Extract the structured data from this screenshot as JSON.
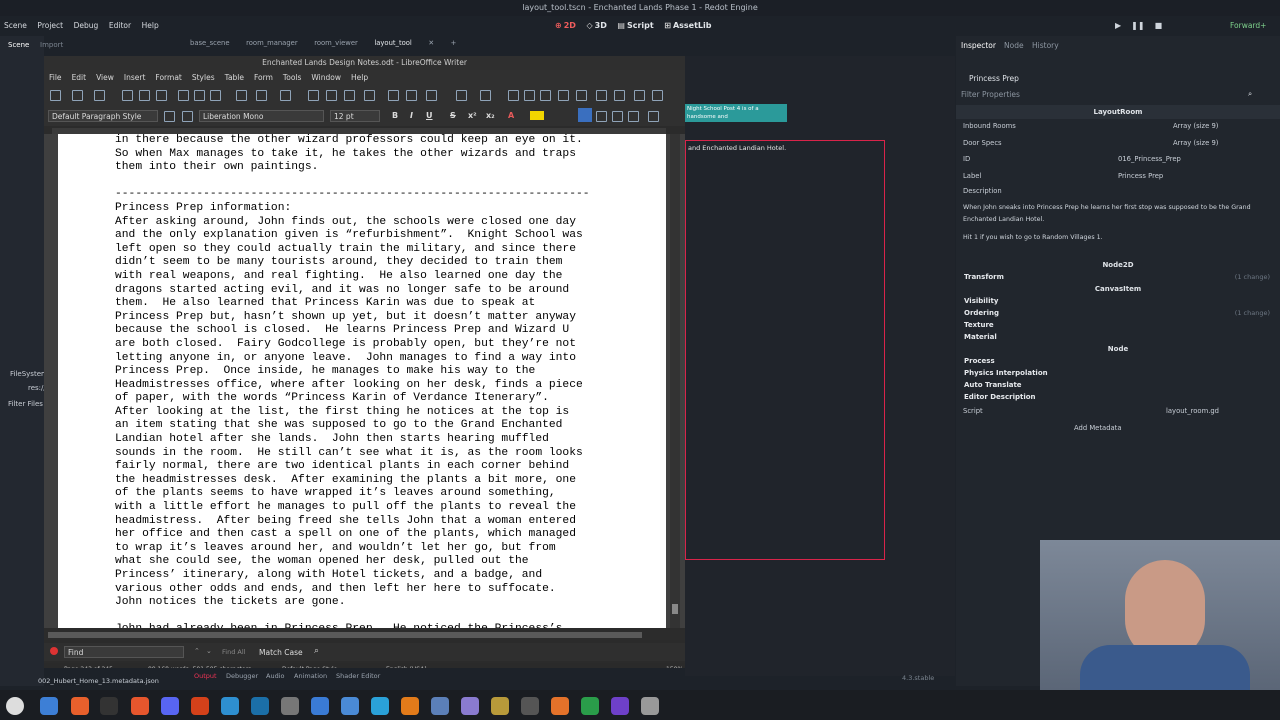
{
  "godot": {
    "window_title": "layout_tool.tscn - Enchanted Lands Phase 1 - Redot Engine",
    "menu": [
      "Scene",
      "Project",
      "Debug",
      "Editor",
      "Help"
    ],
    "main_tabs": [
      "2D",
      "3D",
      "Script",
      "AssetLib"
    ],
    "renderer": "Forward+",
    "left_tabs": [
      "Scene",
      "Import"
    ],
    "scene_tabs": [
      "base_scene",
      "room_manager",
      "room_viewer",
      "layout_tool"
    ],
    "filesystem_label": "FileSystem",
    "res_label": "res://",
    "filter_files": "Filter Files",
    "bottom_file": "002_Hubert_Home_13.metadata.json",
    "bottom_tabs": [
      "Output",
      "Debugger",
      "Audio",
      "Animation",
      "Shader Editor"
    ],
    "version": "4.3.stable"
  },
  "writer": {
    "title": "Enchanted Lands Design Notes.odt - LibreOffice Writer",
    "menu": [
      "File",
      "Edit",
      "View",
      "Insert",
      "Format",
      "Styles",
      "Table",
      "Form",
      "Tools",
      "Window",
      "Help"
    ],
    "paragraph_style": "Default Paragraph Style",
    "font_name": "Liberation Mono",
    "font_size": "12 pt",
    "doc_lines": [
      "in there because the other wizard professors could keep an eye on it.",
      "So when Max manages to take it, he takes the other wizards and traps",
      "them into their own paintings.",
      "",
      "----------------------------------------------------------------------",
      "Princess Prep information:",
      "After asking around, John finds out, the schools were closed one day",
      "and the only explanation given is “refurbishment”.  Knight School was",
      "left open so they could actually train the military, and since there",
      "didn’t seem to be many tourists around, they decided to train them",
      "with real weapons, and real fighting.  He also learned one day the",
      "dragons started acting evil, and it was no longer safe to be around",
      "them.  He also learned that Princess Karin was due to speak at",
      "Princess Prep but, hasn’t shown up yet, but it doesn’t matter anyway",
      "because the school is closed.  He learns Princess Prep and Wizard U",
      "are both closed.  Fairy Godcollege is probably open, but they’re not",
      "letting anyone in, or anyone leave.  John manages to find a way into",
      "Princess Prep.  Once inside, he manages to make his way to the",
      "Headmistresses office, where after looking on her desk, finds a piece",
      "of paper, with the words “Princess Karin of Verdance Itenerary”.",
      "After looking at the list, the first thing he notices at the top is",
      "an item stating that she was supposed to go to the Grand Enchanted",
      "Landian hotel after she lands.  John then starts hearing muffled",
      "sounds in the room.  He still can’t see what it is, as the room looks",
      "fairly normal, there are two identical plants in each corner behind",
      "the headmistresses desk.  After examining the plants a bit more, one",
      "of the plants seems to have wrapped it’s leaves around something,",
      "with a little effort he manages to pull off the plants to reveal the",
      "headmistress.  After being freed she tells John that a woman entered",
      "her office and then cast a spell on one of the plants, which managed",
      "to wrap it’s leaves around her, and wouldn’t let her go, but from",
      "what she could see, the woman opened her desk, pulled out the",
      "Princess’ itinerary, along with Hotel tickets, and a badge, and",
      "various other odds and ends, and then left her here to suffocate.",
      "John notices the tickets are gone.",
      "",
      "John had already been in Princess Prep.  He noticed the Princess’s"
    ],
    "find_placeholder": "Find",
    "find_all": "Find All",
    "match_case": "Match Case",
    "status": {
      "page": "Page 243 of 245",
      "words": "89,168 words, 501,505 characters",
      "page_style": "Default Page Style",
      "language": "English (USA)",
      "zoom": "150%"
    }
  },
  "viewport": {
    "teal_text": "Night School Post 4\nis of a handsome and",
    "frame_text": "and Enchanted Landian Hotel."
  },
  "inspector": {
    "tabs": [
      "Inspector",
      "Node",
      "History"
    ],
    "node_name": "Princess Prep",
    "filter": "Filter Properties",
    "class_header": "LayoutRoom",
    "props": [
      {
        "k": "Inbound Rooms",
        "v": "Array (size 9)"
      },
      {
        "k": "Door Specs",
        "v": "Array (size 9)"
      },
      {
        "k": "ID",
        "v": "016_Princess_Prep"
      },
      {
        "k": "Label",
        "v": "Princess Prep"
      },
      {
        "k": "Description",
        "v": ""
      }
    ],
    "description_text": "When John sneaks into Princess Prep he learns her first stop was supposed to be the Grand Enchanted Landian Hotel.",
    "description_text2": "Hit 1 if you wish to go to Random Villages 1.",
    "node2d": "Node2D",
    "transform": "Transform",
    "transform_change": "(1 change)",
    "canvasitem": "CanvasItem",
    "canvas_cats": [
      "Visibility",
      "Ordering",
      "Texture",
      "Material"
    ],
    "ordering_change": "(1 change)",
    "node": "Node",
    "node_cats": [
      "Process",
      "Physics Interpolation",
      "Auto Translate",
      "Editor Description"
    ],
    "script_label": "Script",
    "script_value": "layout_room.gd",
    "add_metadata": "Add Metadata"
  }
}
